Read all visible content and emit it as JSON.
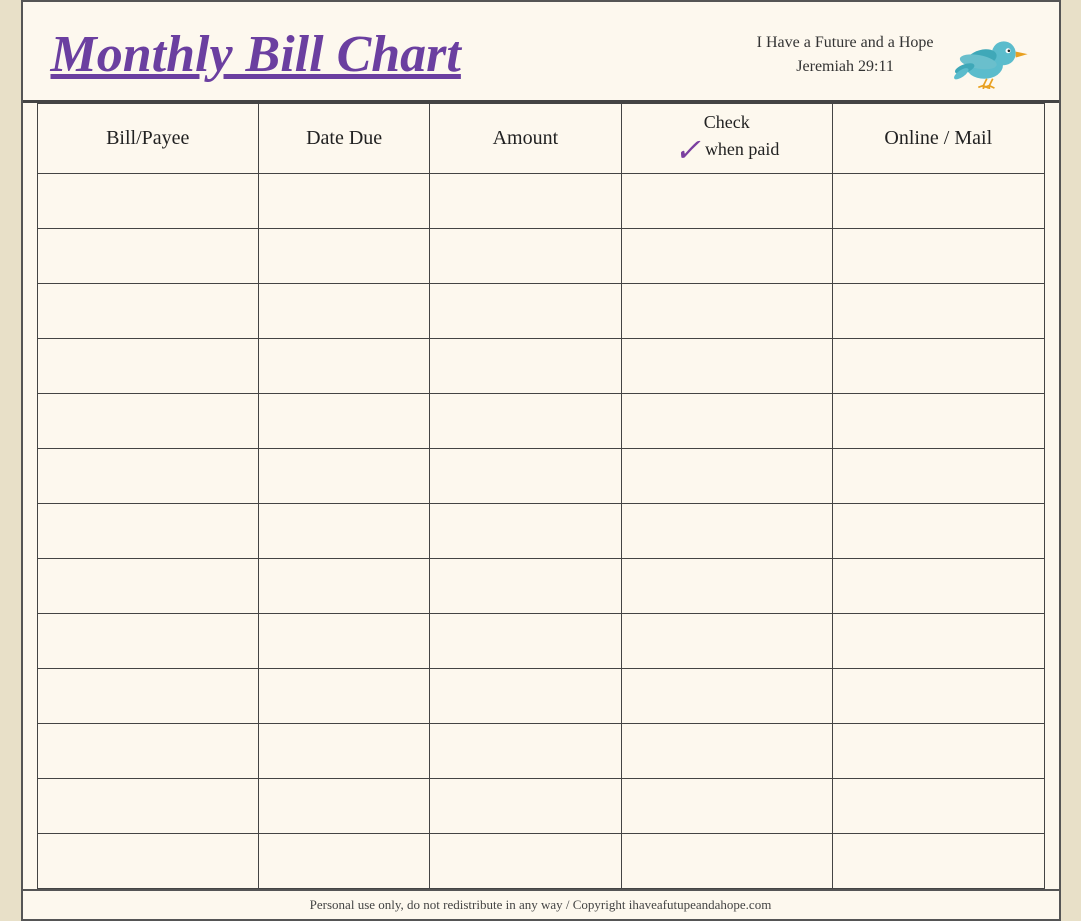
{
  "header": {
    "title": "Monthly Bill Chart",
    "tagline_line1": "I Have a Future and a Hope",
    "tagline_line2": "Jeremiah 29:11"
  },
  "table": {
    "columns": [
      {
        "id": "bill",
        "label": "Bill/Payee"
      },
      {
        "id": "date",
        "label": "Date Due"
      },
      {
        "id": "amount",
        "label": "Amount"
      },
      {
        "id": "check",
        "label": "when paid",
        "prefix": "Check",
        "check_mark": "✓"
      },
      {
        "id": "online",
        "label": "Online / Mail"
      }
    ],
    "row_count": 13
  },
  "footer": {
    "text": "Personal use only, do not redistribute in any way / Copyright ihaveafutuреandahope.com"
  }
}
